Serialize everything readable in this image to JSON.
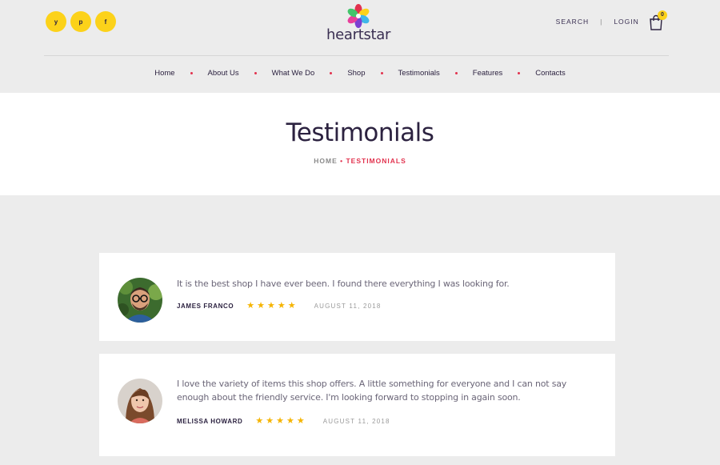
{
  "header": {
    "social": [
      {
        "icon": "twitter-icon",
        "glyph": "y"
      },
      {
        "icon": "pinterest-icon",
        "glyph": "p"
      },
      {
        "icon": "facebook-icon",
        "glyph": "f"
      }
    ],
    "logo_text": "heartstar",
    "search_label": "SEARCH",
    "login_label": "LOGIN",
    "cart_count": "0"
  },
  "nav": [
    "Home",
    "About Us",
    "What We Do",
    "Shop",
    "Testimonials",
    "Features",
    "Contacts"
  ],
  "page": {
    "title": "Testimonials",
    "breadcrumb_home": "HOME",
    "breadcrumb_sep": "•",
    "breadcrumb_current": "TESTIMONIALS"
  },
  "testimonials": [
    {
      "quote": "It is the best shop I have ever been. I found there everything I was looking for.",
      "name": "JAMES FRANCO",
      "rating": 5,
      "date": "AUGUST 11, 2018"
    },
    {
      "quote": "I love the variety of items this shop offers. A little something for everyone and I can not say enough about the friendly service. I'm looking forward to stopping in again soon.",
      "name": "MELISSA HOWARD",
      "rating": 5,
      "date": "AUGUST 11, 2018"
    }
  ],
  "colors": {
    "accent_yellow": "#fcd21a",
    "accent_red": "#e2324e",
    "text_dark": "#2c2240",
    "star": "#f5b400"
  }
}
